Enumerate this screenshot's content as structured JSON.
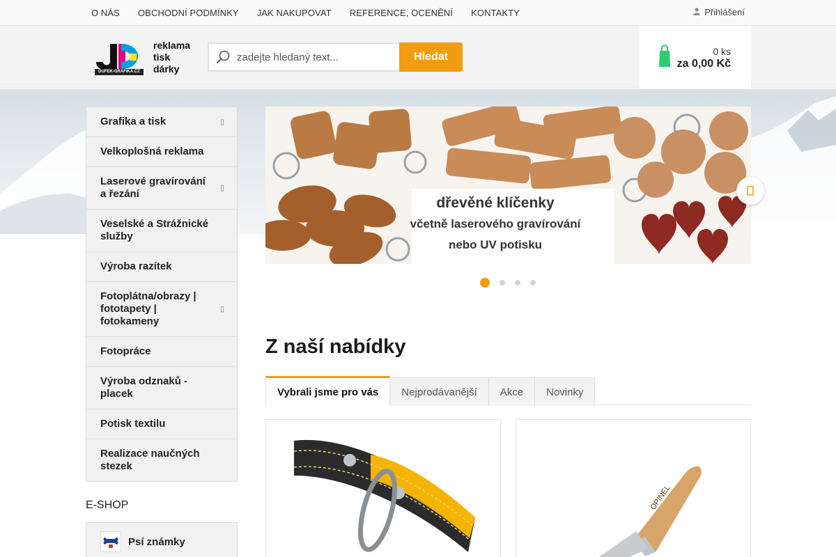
{
  "topnav": {
    "items": [
      "O NÁS",
      "OBCHODNÍ PODMÍNKY",
      "JAK NAKUPOVAT",
      "REFERENCE, OCENĚNÍ",
      "KONTAKTY"
    ],
    "login_label": "Přihlášení",
    "login_icon": "user-icon"
  },
  "logo": {
    "lines": [
      "reklama",
      "tisk",
      "dárky"
    ],
    "url_text": "DUFEK-GRAFIKA.CZ"
  },
  "search": {
    "placeholder": "zadejte hledaný text...",
    "button_label": "Hledat",
    "icon": "search-icon"
  },
  "cart": {
    "count": "0 ks",
    "total": "za 0,00 Kč",
    "icon": "cart-icon"
  },
  "sidebar": {
    "items": [
      {
        "label": "Grafika a tisk",
        "has_submenu": true
      },
      {
        "label": "Velkoplošná reklama",
        "has_submenu": false
      },
      {
        "label": "Laserové gravírování a řezání",
        "has_submenu": true
      },
      {
        "label": "Veselské a Strážnické služby",
        "has_submenu": false
      },
      {
        "label": "Výroba razítek",
        "has_submenu": false
      },
      {
        "label": "Fotoplátna/obrazy | fototapety | fotokameny",
        "has_submenu": true
      },
      {
        "label": "Fotopráce",
        "has_submenu": false
      },
      {
        "label": "Výroba odznaků - placek",
        "has_submenu": false
      },
      {
        "label": "Potisk textilu",
        "has_submenu": false
      },
      {
        "label": "Realizace naučných stezek",
        "has_submenu": false
      }
    ]
  },
  "eshop": {
    "title": "E-SHOP",
    "items": [
      {
        "label": "Psí známky"
      }
    ]
  },
  "banner": {
    "line1": "dřevěné klíčenky",
    "line2": "včetně laserového gravírování",
    "line3": "nebo UV potisku",
    "slide_count": 4,
    "active_slide": 1
  },
  "offers": {
    "title": "Z naší nabídky",
    "tabs": [
      "Vybrali jsme pro vás",
      "Nejprodávanější",
      "Akce",
      "Novinky"
    ],
    "active_tab": 0
  },
  "colors": {
    "accent": "#f39c12",
    "cart_green": "#2ecc71"
  }
}
